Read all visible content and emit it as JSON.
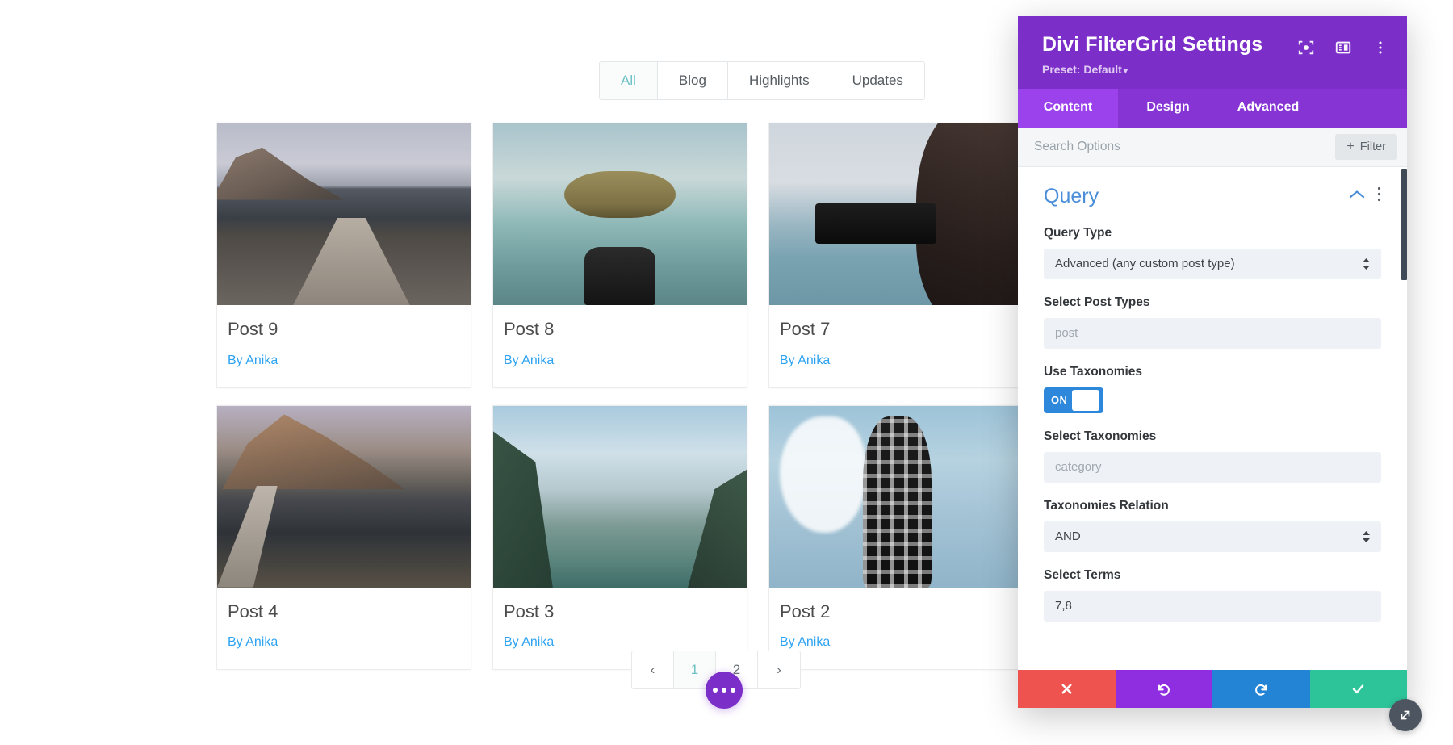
{
  "site": {
    "filter_tabs": [
      {
        "label": "All",
        "active": true
      },
      {
        "label": "Blog",
        "active": false
      },
      {
        "label": "Highlights",
        "active": false
      },
      {
        "label": "Updates",
        "active": false
      }
    ],
    "author_prefix": "By Anika",
    "cards": [
      {
        "title": "Post 9",
        "author": "By Anika",
        "image": "mountain-lake-pier"
      },
      {
        "title": "Post 8",
        "author": "By Anika",
        "image": "coin-binoculars-lake"
      },
      {
        "title": "Post 7",
        "author": "By Anika",
        "image": "person-phone-camera"
      },
      {
        "title": "Post 4",
        "author": "By Anika",
        "image": "mountain-lake-bridge"
      },
      {
        "title": "Post 3",
        "author": "By Anika",
        "image": "lake-louise-valley"
      },
      {
        "title": "Post 2",
        "author": "By Anika",
        "image": "person-plaid-shirt-sky"
      }
    ],
    "pagination": {
      "prev_label": "‹",
      "next_label": "›",
      "pages": [
        {
          "label": "1",
          "current": true
        },
        {
          "label": "2",
          "current": false
        }
      ]
    },
    "fab_label": "more-options"
  },
  "panel": {
    "title": "Divi FilterGrid Settings",
    "preset": "Preset: Default",
    "preset_caret": "▾",
    "header_icons": [
      {
        "name": "focus-target-icon"
      },
      {
        "name": "layout-columns-icon"
      },
      {
        "name": "kebab-menu-icon"
      }
    ],
    "tabs": [
      {
        "label": "Content",
        "active": true
      },
      {
        "label": "Design",
        "active": false
      },
      {
        "label": "Advanced",
        "active": false
      }
    ],
    "search": {
      "value": "",
      "placeholder": "Search Options"
    },
    "filter_button": {
      "label": "Filter",
      "plus": "+"
    },
    "section": {
      "title": "Query",
      "collapse_icon": "chevron-up-icon",
      "menu_icon": "kebab-menu-icon"
    },
    "fields": [
      {
        "label": "Query Type",
        "type": "select",
        "value": "Advanced (any custom post type)",
        "placeholder": false
      },
      {
        "label": "Select Post Types",
        "type": "text",
        "value": "post",
        "placeholder": true
      },
      {
        "label": "Use Taxonomies",
        "type": "toggle",
        "value": "ON",
        "on": true
      },
      {
        "label": "Select Taxonomies",
        "type": "text",
        "value": "category",
        "placeholder": true
      },
      {
        "label": "Taxonomies Relation",
        "type": "select",
        "value": "AND",
        "placeholder": false
      },
      {
        "label": "Select Terms",
        "type": "text",
        "value": "7,8",
        "placeholder": false
      }
    ],
    "footer_buttons": [
      {
        "name": "cancel",
        "icon": "close-x-icon",
        "color": "#ef5350"
      },
      {
        "name": "undo",
        "icon": "undo-arrow-icon",
        "color": "#8e2ee0"
      },
      {
        "name": "redo",
        "icon": "redo-arrow-icon",
        "color": "#2384d6"
      },
      {
        "name": "save",
        "icon": "checkmark-icon",
        "color": "#2ec49a"
      }
    ],
    "resize_handle_icon": "resize-diagonal-icon",
    "colors": {
      "header_purple": "#7b2ec8",
      "tab_active_purple": "#9b42ed",
      "tab_bar_purple": "#8734d4",
      "section_title_blue": "#4a8ed9",
      "toggle_on_blue": "#2d87da",
      "accent_teal": "#6ec1c4",
      "link_blue": "#2ea3f2"
    }
  }
}
